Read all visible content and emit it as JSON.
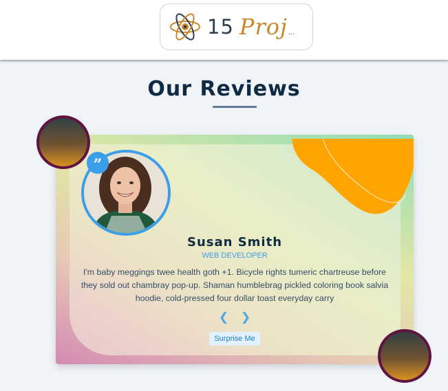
{
  "header": {
    "logo_number": "15",
    "logo_word": "Proj",
    "logo_dots": "...",
    "logo_icon": "atom-icon"
  },
  "section": {
    "title": "Our Reviews"
  },
  "review": {
    "name": "Susan Smith",
    "job": "web developer",
    "text": "I'm baby meggings twee health goth +1. Bicycle rights tumeric chartreuse before they sold out chambray pop-up. Shaman humblebrag pickled coloring book salvia hoodie, cold-pressed four dollar toast everyday carry",
    "quote_glyph": "”",
    "quote_icon": "quote-icon",
    "avatar": "person-photo"
  },
  "controls": {
    "prev_glyph": "❮",
    "next_glyph": "❯",
    "prev_icon": "chevron-left-icon",
    "next_icon": "chevron-right-icon",
    "random_label": "Surprise Me"
  },
  "colors": {
    "accent_blue": "#3b9ee8",
    "title_dark": "#102a43",
    "blob_orange": "#ffa400",
    "deco_border": "#5a0b3c"
  }
}
